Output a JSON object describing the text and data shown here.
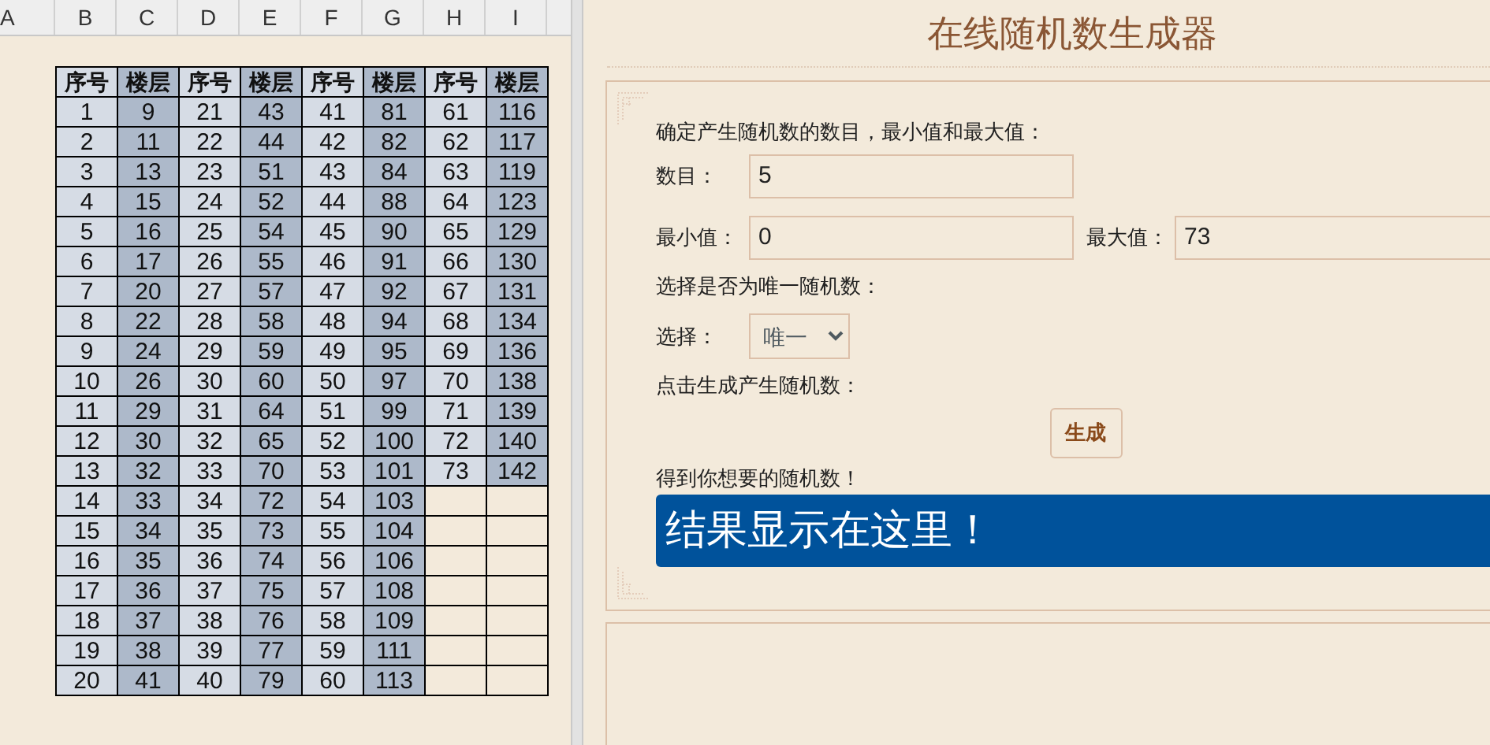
{
  "spreadsheet": {
    "column_letters": [
      "A",
      "B",
      "C",
      "D",
      "E",
      "F",
      "G",
      "H",
      "I"
    ],
    "table": {
      "columns": [
        "序号",
        "楼层",
        "序号",
        "楼层",
        "序号",
        "楼层",
        "序号",
        "楼层"
      ],
      "rows": [
        [
          "1",
          "9",
          "21",
          "43",
          "41",
          "81",
          "61",
          "116"
        ],
        [
          "2",
          "11",
          "22",
          "44",
          "42",
          "82",
          "62",
          "117"
        ],
        [
          "3",
          "13",
          "23",
          "51",
          "43",
          "84",
          "63",
          "119"
        ],
        [
          "4",
          "15",
          "24",
          "52",
          "44",
          "88",
          "64",
          "123"
        ],
        [
          "5",
          "16",
          "25",
          "54",
          "45",
          "90",
          "65",
          "129"
        ],
        [
          "6",
          "17",
          "26",
          "55",
          "46",
          "91",
          "66",
          "130"
        ],
        [
          "7",
          "20",
          "27",
          "57",
          "47",
          "92",
          "67",
          "131"
        ],
        [
          "8",
          "22",
          "28",
          "58",
          "48",
          "94",
          "68",
          "134"
        ],
        [
          "9",
          "24",
          "29",
          "59",
          "49",
          "95",
          "69",
          "136"
        ],
        [
          "10",
          "26",
          "30",
          "60",
          "50",
          "97",
          "70",
          "138"
        ],
        [
          "11",
          "29",
          "31",
          "64",
          "51",
          "99",
          "71",
          "139"
        ],
        [
          "12",
          "30",
          "32",
          "65",
          "52",
          "100",
          "72",
          "140"
        ],
        [
          "13",
          "32",
          "33",
          "70",
          "53",
          "101",
          "73",
          "142"
        ],
        [
          "14",
          "33",
          "34",
          "72",
          "54",
          "103"
        ],
        [
          "15",
          "34",
          "35",
          "73",
          "55",
          "104"
        ],
        [
          "16",
          "35",
          "36",
          "74",
          "56",
          "106"
        ],
        [
          "17",
          "36",
          "37",
          "75",
          "57",
          "108"
        ],
        [
          "18",
          "37",
          "38",
          "76",
          "58",
          "109"
        ],
        [
          "19",
          "38",
          "39",
          "77",
          "59",
          "111"
        ],
        [
          "20",
          "41",
          "40",
          "79",
          "60",
          "113"
        ]
      ]
    }
  },
  "page": {
    "title": "在线随机数生成器",
    "intro": "确定产生随机数的数目，最小值和最大值：",
    "count": {
      "label": "数目：",
      "value": "5"
    },
    "min": {
      "label": "最小值：",
      "value": "0"
    },
    "max": {
      "label": "最大值：",
      "value": "73"
    },
    "unique_prompt": "选择是否为唯一随机数：",
    "choice": {
      "label": "选择：",
      "value": "唯一"
    },
    "generate_prompt": "点击生成产生随机数：",
    "generate_button": "生成",
    "result_prompt": "得到你想要的随机数！",
    "result": "结果显示在这里！"
  }
}
